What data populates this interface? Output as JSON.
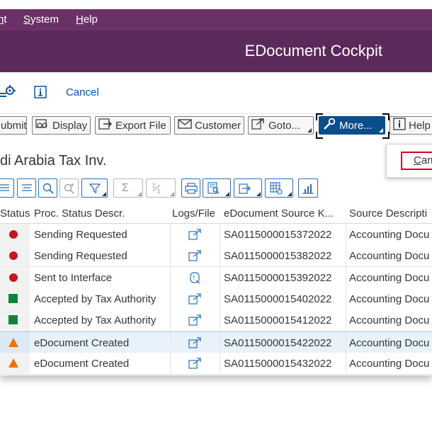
{
  "menubar": {
    "items": [
      {
        "pre": "",
        "key": "n",
        "post": "t"
      },
      {
        "pre": "",
        "key": "S",
        "post": "ystem"
      },
      {
        "pre": "",
        "key": "H",
        "post": "elp"
      }
    ]
  },
  "header": {
    "title": "EDocument Cockpit"
  },
  "app_toolbar": {
    "cancel_label": "Cancel"
  },
  "buttons": {
    "submit": "ubmit",
    "display": "Display",
    "export": "Export File",
    "customer": "Customer",
    "goto": "Goto...",
    "more": "More...",
    "help": "Help"
  },
  "popup": {
    "item_key": "C",
    "item_rest": "an"
  },
  "section": {
    "title": "di Arabia Tax Inv."
  },
  "table": {
    "columns": [
      "Status",
      "Proc. Status Descr.",
      "Logs/File",
      "eDocument Source K...",
      "Source Descripti"
    ],
    "rows": [
      {
        "status": "red-circle",
        "descr": "Sending Requested",
        "log_icon": "export-icon",
        "source_key": "SA0115000015372022",
        "source_desc": "Accounting Docu"
      },
      {
        "status": "red-circle",
        "descr": "Sending Requested",
        "log_icon": "export-icon",
        "source_key": "SA0115000015382022",
        "source_desc": "Accounting Docu"
      },
      {
        "status": "red-circle",
        "descr": "Sent to Interface",
        "log_icon": "log-detail-icon",
        "source_key": "SA0115000015392022",
        "source_desc": "Accounting Docu"
      },
      {
        "status": "green-square",
        "descr": "Accepted by Tax Authority",
        "log_icon": "export-icon",
        "source_key": "SA0115000015402022",
        "source_desc": "Accounting Docu"
      },
      {
        "status": "green-square",
        "descr": "Accepted by Tax Authority",
        "log_icon": "export-icon",
        "source_key": "SA0115000015412022",
        "source_desc": "Accounting Docu"
      },
      {
        "status": "orange-triangle",
        "descr": "eDocument Created",
        "log_icon": "export-icon",
        "source_key": "SA0115000015422022",
        "source_desc": "Accounting Docu"
      },
      {
        "status": "orange-triangle",
        "descr": "eDocument Created",
        "log_icon": "export-icon",
        "source_key": "SA0115000015432022",
        "source_desc": "Accounting Docu"
      }
    ]
  },
  "colors": {
    "menubar": "#6a3167",
    "titlebar": "#5c2a5a",
    "accent_blue": "#0a4d8c",
    "status_red": "#c8161e",
    "status_green": "#15803d",
    "status_orange": "#e9730c",
    "highlight_red": "#d6001c"
  }
}
